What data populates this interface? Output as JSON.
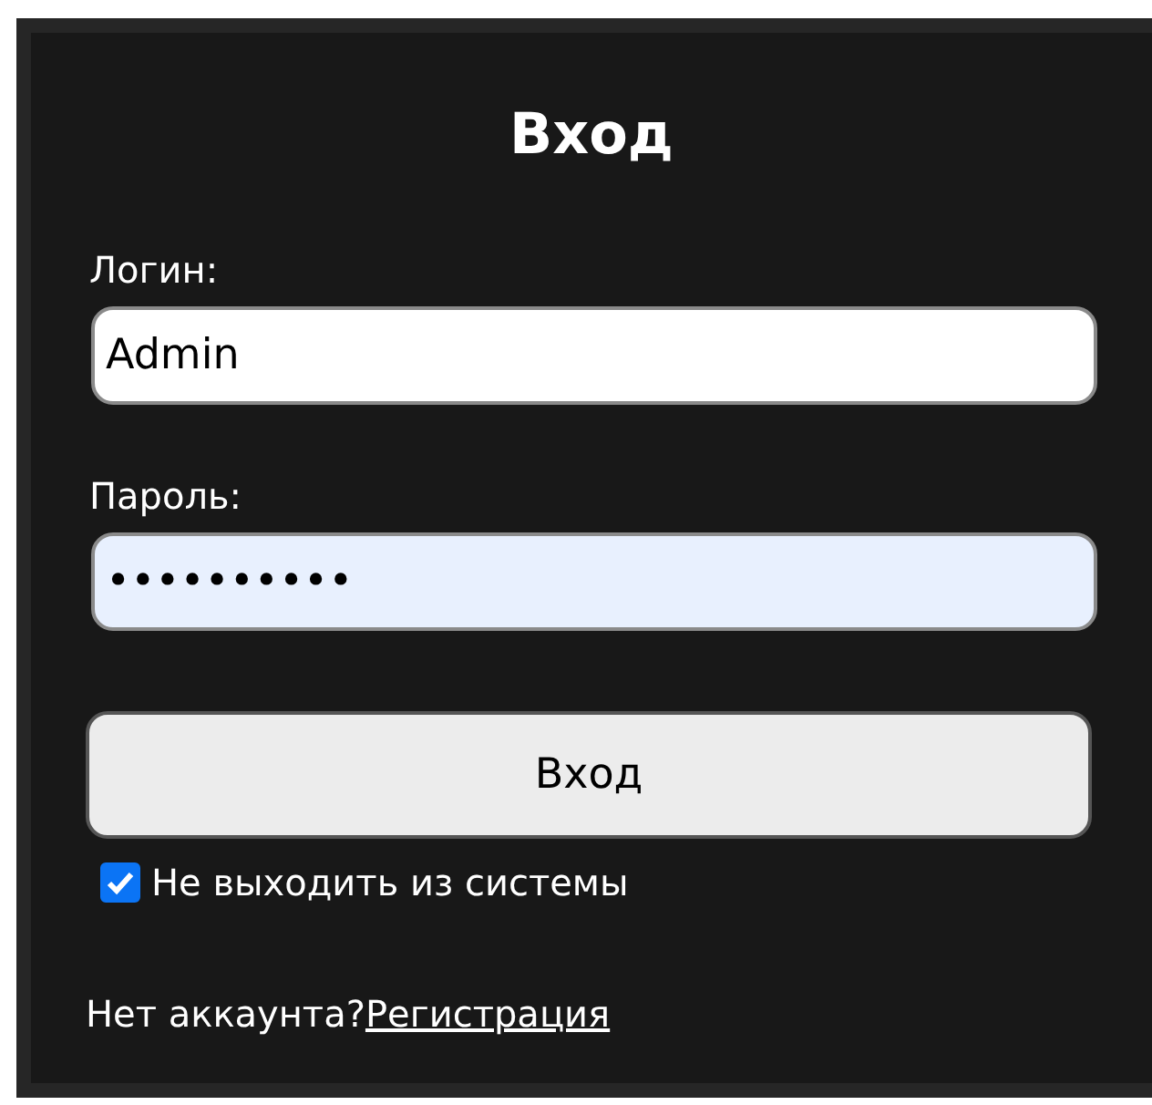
{
  "title": "Вход",
  "fields": [
    {
      "label": "Логин:",
      "value": "Admin",
      "autofilled": false
    },
    {
      "label": "Пароль:",
      "value": "••••••••••",
      "autofilled": true
    }
  ],
  "submit": "Вход",
  "remember": {
    "label": "Не выходить из системы",
    "checked": true
  },
  "footer": {
    "text": "Нет аккаунта?",
    "link": "Регистрация"
  }
}
